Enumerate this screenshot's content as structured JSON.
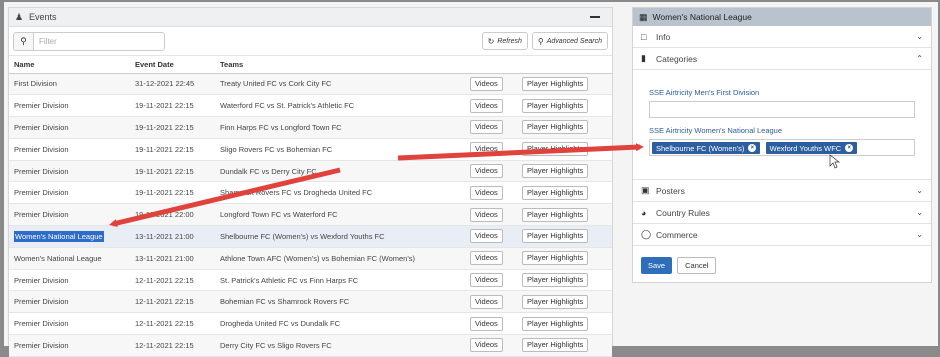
{
  "events": {
    "title": "Events",
    "filter_placeholder": "Filter",
    "refresh_label": "Refresh",
    "advanced_search_label": "Advanced Search",
    "columns": [
      "Name",
      "Event Date",
      "Teams"
    ],
    "rows": [
      {
        "name": "First Division",
        "date": "31-12-2021 22:45",
        "teams": "Treaty United FC vs Cork City FC"
      },
      {
        "name": "Premier Division",
        "date": "19-11-2021 22:15",
        "teams": "Waterford FC vs St. Patrick's Athletic FC"
      },
      {
        "name": "Premier Division",
        "date": "19-11-2021 22:15",
        "teams": "Finn Harps FC vs Longford Town FC"
      },
      {
        "name": "Premier Division",
        "date": "19-11-2021 22:15",
        "teams": "Sligo Rovers FC vs Bohemian FC"
      },
      {
        "name": "Premier Division",
        "date": "19-11-2021 22:15",
        "teams": "Dundalk FC vs Derry City FC"
      },
      {
        "name": "Premier Division",
        "date": "19-11-2021 22:15",
        "teams": "Shamrock Rovers FC vs Drogheda United FC"
      },
      {
        "name": "Premier Division",
        "date": "19-11-2021 22:00",
        "teams": "Longford Town FC vs Waterford FC"
      },
      {
        "name": "Women's National League",
        "date": "13-11-2021 21:00",
        "teams": "Shelbourne FC (Women's) vs Wexford Youths FC"
      },
      {
        "name": "Women's National League",
        "date": "13-11-2021 21:00",
        "teams": "Athlone Town AFC (Women's) vs Bohemian FC (Women's)"
      },
      {
        "name": "Premier Division",
        "date": "12-11-2021 22:15",
        "teams": "St. Patrick's Athletic FC vs Finn Harps FC"
      },
      {
        "name": "Premier Division",
        "date": "12-11-2021 22:15",
        "teams": "Bohemian FC vs Shamrock Rovers FC"
      },
      {
        "name": "Premier Division",
        "date": "12-11-2021 22:15",
        "teams": "Drogheda United FC vs Dundalk FC"
      },
      {
        "name": "Premier Division",
        "date": "12-11-2021 22:15",
        "teams": "Derry City FC vs Sligo Rovers FC"
      }
    ],
    "videos_label": "Videos",
    "highlights_label": "Player Highlights"
  },
  "side": {
    "title": "Women's National League",
    "info_label": "Info",
    "categories_label": "Categories",
    "cat1_label": "SSE Airtricity Men's First Division",
    "cat2_label": "SSE Airtricity Women's National League",
    "tags": [
      "Shelbourne FC (Women's)",
      "Wexford Youths WFC"
    ],
    "posters_label": "Posters",
    "country_rules_label": "Country Rules",
    "commerce_label": "Commerce",
    "save_label": "Save",
    "cancel_label": "Cancel"
  },
  "colors": {
    "accent": "#2f6eb8",
    "arrow": "#e0423c",
    "header": "#b9c3cd"
  }
}
